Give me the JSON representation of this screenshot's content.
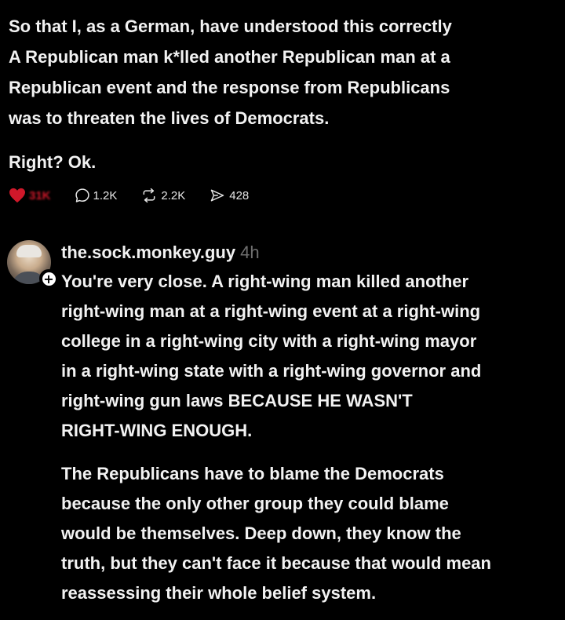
{
  "post": {
    "lines": [
      "So that I, as a German, have understood this correctly",
      "A Republican man k*lled another Republican man at a",
      "Republican event and the response from Republicans",
      "was to threaten the lives of Democrats."
    ],
    "closing": "Right? Ok."
  },
  "actions": {
    "likes": "31K",
    "comments": "1.2K",
    "reposts": "2.2K",
    "shares": "428"
  },
  "reply": {
    "username": "the.sock.monkey.guy",
    "timestamp": "4h",
    "paragraph1": [
      "You're very close. A right-wing man killed another",
      "right-wing man at a right-wing event at a right-wing",
      "college in a right-wing city with a right-wing mayor",
      "in a right-wing state with a right-wing governor and",
      "right-wing gun laws BECAUSE HE WASN'T",
      "RIGHT-WING ENOUGH."
    ],
    "paragraph2": [
      "The Republicans have to blame the Democrats",
      "because the only other group they could blame",
      "would be themselves. Deep down, they know the",
      "truth, but they can't face it because that would mean",
      "reassessing their whole belief system."
    ]
  },
  "colors": {
    "background": "#000000",
    "text": "#f2f2f2",
    "like_red": "#d0182a",
    "timestamp_gray": "#6f6f6f"
  },
  "icons": [
    "heart-icon",
    "comment-icon",
    "repost-icon",
    "share-icon",
    "follow-plus-icon"
  ]
}
